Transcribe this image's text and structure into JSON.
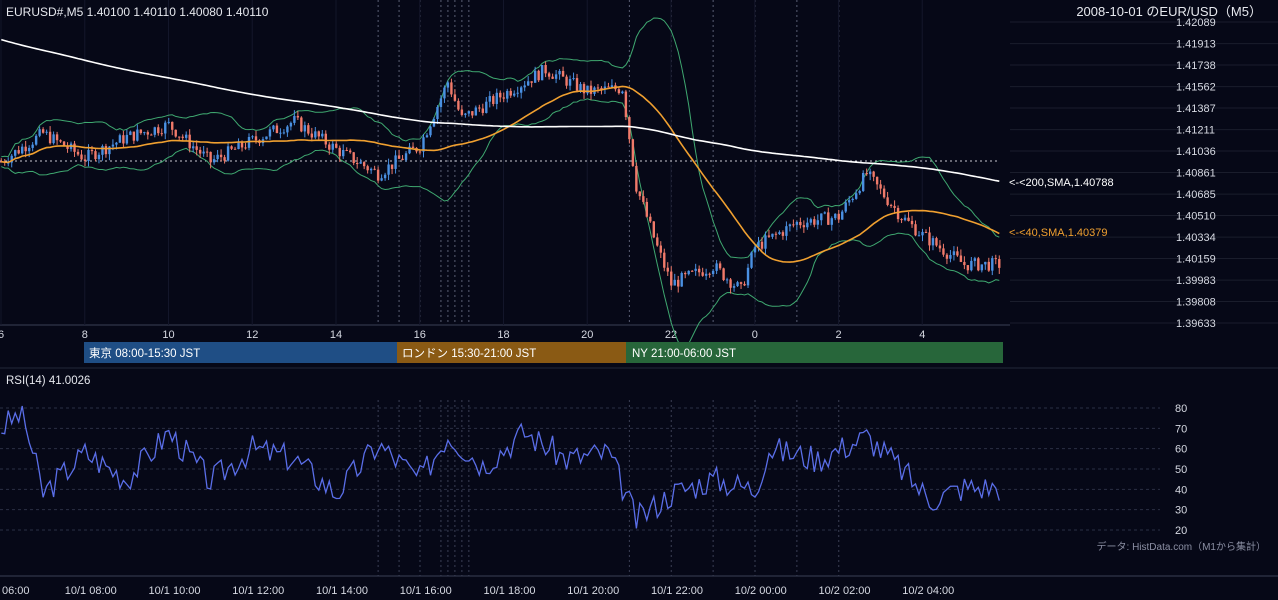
{
  "header": {
    "symbol_line": "EURUSD#,M5 1.40100 1.40110 1.40080 1.40110",
    "right_title": "2008-10-01 のEUR/USD（M5）"
  },
  "colors": {
    "background": "#060817",
    "candle_up": "#4a90e2",
    "candle_down": "#f07a6a",
    "sma200": "#ffffff",
    "sma40": "#f0a030",
    "bollinger": "#3fa870",
    "rsi": "#5a6ee8",
    "tokyo": "#1f4e85",
    "london": "#8a5a14",
    "ny": "#27663a"
  },
  "price_axis": {
    "ticks": [
      "1.42089",
      "1.41913",
      "1.41738",
      "1.41562",
      "1.41387",
      "1.41211",
      "1.41036",
      "1.40861",
      "1.40685",
      "1.40510",
      "1.40334",
      "1.40159",
      "1.39983",
      "1.39808",
      "1.39633"
    ]
  },
  "upper_time_axis": {
    "ticks": [
      "6",
      "8",
      "10",
      "12",
      "14",
      "16",
      "18",
      "20",
      "22",
      "0",
      "2",
      "4"
    ]
  },
  "indicators": {
    "sma200_label": "<-<200,SMA,1.40788",
    "sma40_label": "<-<40,SMA,1.40379"
  },
  "sessions": [
    {
      "label": "東京 08:00-15:30 JST"
    },
    {
      "label": "ロンドン 15:30-21:00 JST"
    },
    {
      "label": "NY 21:00-06:00 JST"
    }
  ],
  "rsi": {
    "title": "RSI(14) 41.0026",
    "ticks": [
      "80",
      "70",
      "60",
      "50",
      "40",
      "30",
      "20"
    ]
  },
  "footer": {
    "source": "データ: HistData.com（M1から集計）"
  },
  "bottom_axis": {
    "ticks": [
      "06:00",
      "10/1 08:00",
      "10/1 10:00",
      "10/1 12:00",
      "10/1 14:00",
      "10/1 16:00",
      "10/1 18:00",
      "10/1 20:00",
      "10/1 22:00",
      "10/2 00:00",
      "10/2 02:00",
      "10/2 04:00"
    ]
  },
  "chart_data": {
    "type": "candlestick",
    "instrument": "EURUSD#",
    "timeframe": "M5",
    "ylim": [
      1.39633,
      1.42089
    ],
    "sma200_value": 1.40788,
    "sma40_value": 1.40379,
    "reference_level": 1.40961,
    "key_points": [
      {
        "x": "10/1 06:00",
        "close": 1.4095
      },
      {
        "x": "10/1 07:00",
        "close": 1.4118
      },
      {
        "x": "10/1 08:00",
        "close": 1.4098
      },
      {
        "x": "10/1 09:00",
        "close": 1.4115
      },
      {
        "x": "10/1 10:00",
        "close": 1.4125
      },
      {
        "x": "10/1 11:00",
        "close": 1.4095
      },
      {
        "x": "10/1 12:00",
        "close": 1.4112
      },
      {
        "x": "10/1 13:00",
        "close": 1.4128
      },
      {
        "x": "10/1 14:00",
        "close": 1.4105
      },
      {
        "x": "10/1 15:00",
        "close": 1.4085
      },
      {
        "x": "10/1 16:00",
        "close": 1.4108
      },
      {
        "x": "10/1 16:40",
        "close": 1.416
      },
      {
        "x": "10/1 17:00",
        "close": 1.413
      },
      {
        "x": "10/1 18:00",
        "close": 1.415
      },
      {
        "x": "10/1 19:00",
        "close": 1.417
      },
      {
        "x": "10/1 20:00",
        "close": 1.4152
      },
      {
        "x": "10/1 20:50",
        "close": 1.4155
      },
      {
        "x": "10/1 21:10",
        "close": 1.4075
      },
      {
        "x": "10/1 21:40",
        "close": 1.4025
      },
      {
        "x": "10/1 22:00",
        "close": 1.3995
      },
      {
        "x": "10/1 23:00",
        "close": 1.401
      },
      {
        "x": "10/1 23:40",
        "close": 1.399
      },
      {
        "x": "10/2 00:00",
        "close": 1.4025
      },
      {
        "x": "10/2 01:00",
        "close": 1.4045
      },
      {
        "x": "10/2 02:00",
        "close": 1.405
      },
      {
        "x": "10/2 02:40",
        "close": 1.4085
      },
      {
        "x": "10/2 03:30",
        "close": 1.405
      },
      {
        "x": "10/2 04:00",
        "close": 1.4035
      },
      {
        "x": "10/2 05:00",
        "close": 1.4011
      }
    ],
    "rsi_points": [
      {
        "x": "10/1 06:00",
        "v": 70
      },
      {
        "x": "10/1 06:30",
        "v": 78
      },
      {
        "x": "10/1 07:00",
        "v": 38
      },
      {
        "x": "10/1 08:00",
        "v": 58
      },
      {
        "x": "10/1 09:00",
        "v": 45
      },
      {
        "x": "10/1 10:00",
        "v": 68
      },
      {
        "x": "10/1 11:00",
        "v": 44
      },
      {
        "x": "10/1 12:00",
        "v": 60
      },
      {
        "x": "10/1 13:00",
        "v": 55
      },
      {
        "x": "10/1 14:00",
        "v": 38
      },
      {
        "x": "10/1 15:00",
        "v": 62
      },
      {
        "x": "10/1 16:00",
        "v": 45
      },
      {
        "x": "10/1 16:40",
        "v": 67
      },
      {
        "x": "10/1 17:30",
        "v": 52
      },
      {
        "x": "10/1 18:30",
        "v": 68
      },
      {
        "x": "10/1 19:30",
        "v": 55
      },
      {
        "x": "10/1 20:30",
        "v": 58
      },
      {
        "x": "10/1 21:10",
        "v": 25
      },
      {
        "x": "10/1 22:00",
        "v": 38
      },
      {
        "x": "10/1 23:00",
        "v": 45
      },
      {
        "x": "10/2 00:00",
        "v": 40
      },
      {
        "x": "10/2 00:20",
        "v": 60
      },
      {
        "x": "10/2 01:30",
        "v": 55
      },
      {
        "x": "10/2 02:40",
        "v": 66
      },
      {
        "x": "10/2 03:30",
        "v": 50
      },
      {
        "x": "10/2 04:10",
        "v": 35
      },
      {
        "x": "10/2 05:00",
        "v": 41
      }
    ]
  }
}
